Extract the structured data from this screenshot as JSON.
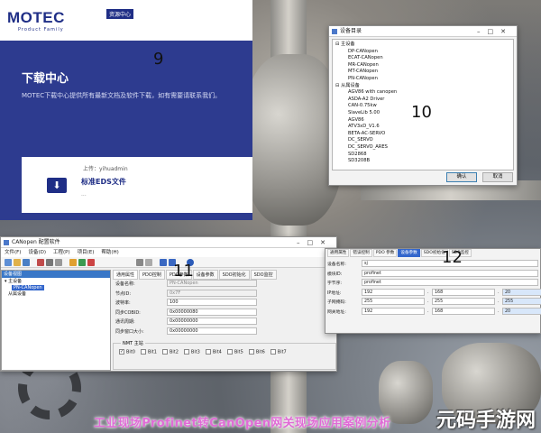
{
  "motec": {
    "logo": "MOTEC",
    "logo_sub": "Product Family",
    "badge": "资源中心",
    "title": "下载中心",
    "description": "MOTEC下载中心提供所有最新文档及软件下载，如有需要请联系我们。",
    "uploader": "上传：yihuadmin",
    "file_title": "标准EDS文件",
    "file_meta": "..."
  },
  "device_dialog": {
    "title": "设备目录",
    "categories": [
      {
        "name": "主设备",
        "items": [
          "DP-CANopen",
          "ECAT-CANopen",
          "MR-CANopen",
          "MT-CANopen",
          "PN-CANopen"
        ]
      },
      {
        "name": "从属设备",
        "items": [
          "AGV86 with canopen",
          "ASDA-A2 Driver",
          "CAN-0.75kw",
          "SlaveLib 5.00",
          "AGV86",
          "ATV3xD_V1.6",
          "BETA-AC-SERVO",
          "DC_SERVO",
          "DC_SERVO_ARES",
          "SD2868",
          "SD3208B"
        ]
      }
    ],
    "ok_label": "确认",
    "cancel_label": "取消"
  },
  "config_window": {
    "title": "CANopen 配置软件",
    "menu": [
      "文件(F)",
      "设备(D)",
      "工程(P)",
      "项目(E)",
      "帮助(H)"
    ],
    "left_header": "设备视图",
    "tree": {
      "root": "主设备",
      "selected": "PN-CANopen",
      "sub": "从属设备"
    },
    "tabs": [
      "通用属性",
      "PDO控制",
      "PDO参数",
      "设备参数",
      "SDO初始化",
      "SDO监控"
    ],
    "fields": [
      {
        "label": "设备名称:",
        "value": "PN-CANopen",
        "disabled": true
      },
      {
        "label": "节点ID:",
        "value": "0x7F",
        "disabled": true
      },
      {
        "label": "波特率:",
        "value": "100",
        "disabled": false
      },
      {
        "label": "同步COBID:",
        "value": "0x00000080",
        "disabled": false
      },
      {
        "label": "通讯周期:",
        "value": "0x00000000",
        "disabled": false
      },
      {
        "label": "同步窗口大小:",
        "value": "0x00000000",
        "disabled": false
      }
    ],
    "nmt_title": "NMT 主站",
    "bits": [
      "Bit0",
      "Bit1",
      "Bit2",
      "Bit3",
      "Bit4",
      "Bit5",
      "Bit6",
      "Bit7"
    ],
    "bits_checked": [
      true,
      false,
      false,
      false,
      false,
      false,
      false,
      false
    ]
  },
  "params_window": {
    "tabs": [
      "通用属性",
      "错误控制",
      "PDO 参数",
      "设备参数",
      "SDO初始化",
      "SDO监控"
    ],
    "active_tab": "设备参数",
    "rows": [
      {
        "label": "设备名称:",
        "values": [
          "sj"
        ]
      },
      {
        "label": "模块ID:",
        "values": [
          "profinet"
        ]
      },
      {
        "label": "字节序:",
        "values": [
          "profinet"
        ]
      },
      {
        "label": "IP地址:",
        "values": [
          "192",
          "168",
          "20"
        ]
      },
      {
        "label": "子网掩码:",
        "values": [
          "255",
          "255",
          "255"
        ]
      },
      {
        "label": "网关地址:",
        "values": [
          "192",
          "168",
          "20"
        ]
      }
    ]
  },
  "overlay_numbers": {
    "n9": "9",
    "n10": "10",
    "n11": "11",
    "n12": "12"
  },
  "caption": "工业现场Profinet转CanOpen网关现场应用案例分析",
  "watermark": "元码手游网"
}
